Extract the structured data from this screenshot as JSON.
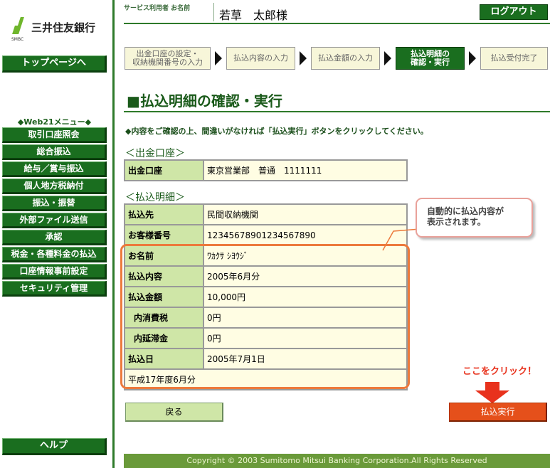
{
  "brand": {
    "name": "三井住友銀行",
    "sub": "SMBC"
  },
  "sidebar": {
    "top_button": "トップページへ",
    "menu_title": "◆Web21メニュー◆",
    "items": [
      "取引口座照会",
      "総合振込",
      "給与／賞与振込",
      "個人地方税納付",
      "振込・振替",
      "外部ファイル送信",
      "承認",
      "税金・各種料金の払込",
      "口座情報事前設定",
      "セキュリティ管理"
    ],
    "help_button": "ヘルプ"
  },
  "header": {
    "label": "サービス利用者 お名前",
    "user_name": "若草　太郎様",
    "logout": "ログアウト"
  },
  "steps": [
    {
      "line1": "出金口座の設定・",
      "line2": "収納機関番号の入力",
      "current": false
    },
    {
      "line1": "払込内容の入力",
      "line2": "",
      "current": false
    },
    {
      "line1": "払込金額の入力",
      "line2": "",
      "current": false
    },
    {
      "line1": "払込明細の",
      "line2": "確認・実行",
      "current": true
    },
    {
      "line1": "払込受付完了",
      "line2": "",
      "current": false
    }
  ],
  "page": {
    "title": "■払込明細の確認・実行",
    "instruction": "◆内容をご確認の上、間違いがなければ「払込実行」ボタンをクリックしてください。"
  },
  "withdrawal": {
    "title": "＜出金口座＞",
    "label": "出金口座",
    "value": "東京営業部　普通　1111111"
  },
  "details": {
    "title": "＜払込明細＞",
    "rows": [
      {
        "label": "払込先",
        "value": "民間収納機関"
      },
      {
        "label": "お客様番号",
        "value": "12345678901234567890"
      },
      {
        "label": "お名前",
        "value": "ﾜｶｸｻ ｼﾖｳｼﾞ"
      },
      {
        "label": "払込内容",
        "value": "2005年6月分"
      },
      {
        "label": "払込金額",
        "value": "10,000円"
      },
      {
        "label": "内消費税",
        "value": "0円"
      },
      {
        "label": "内延滞金",
        "value": "0円"
      },
      {
        "label": "払込日",
        "value": "2005年7月1日"
      }
    ],
    "note": "平成17年度6月分"
  },
  "callout": {
    "line1": "自動的に払込内容が",
    "line2": "表示されます。"
  },
  "click_hint": "ここをクリック！",
  "buttons": {
    "back": "戻る",
    "execute": "払込実行"
  },
  "footer": "Copyright © 2003 Sumitomo Mitsui Banking Corporation.All Rights Reserved",
  "colors": {
    "brand_green": "#1a6e1f",
    "accent_orange": "#e5501b",
    "label_green": "#cfe6a7",
    "value_cream": "#fffde3"
  }
}
